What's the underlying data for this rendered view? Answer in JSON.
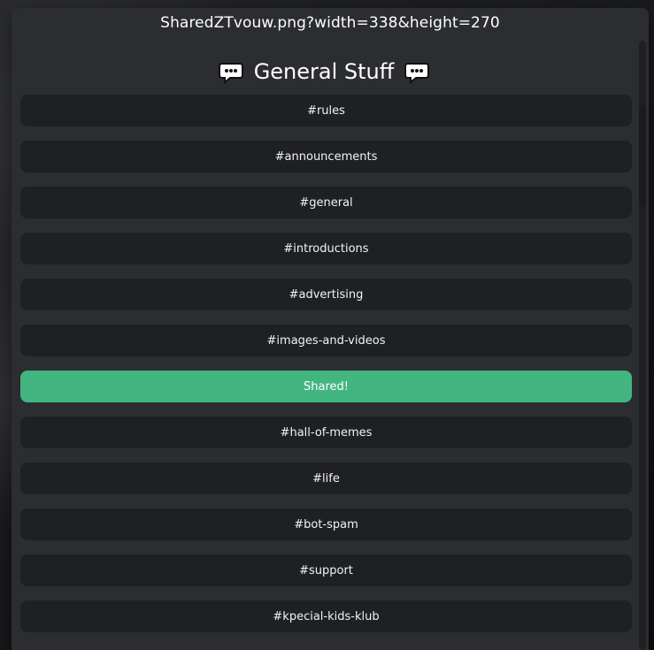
{
  "window": {
    "title": "SharedZTvouw.png?width=338&height=270"
  },
  "header": {
    "title": "General Stuff",
    "left_icon": "speech-bubble-icon",
    "right_icon": "speech-bubble-icon"
  },
  "channels": [
    {
      "label": "#rules",
      "active": false
    },
    {
      "label": "#announcements",
      "active": false
    },
    {
      "label": "#general",
      "active": false
    },
    {
      "label": "#introductions",
      "active": false
    },
    {
      "label": "#advertising",
      "active": false
    },
    {
      "label": "#images-and-videos",
      "active": false
    },
    {
      "label": "Shared!",
      "active": true
    },
    {
      "label": "#hall-of-memes",
      "active": false
    },
    {
      "label": "#life",
      "active": false
    },
    {
      "label": "#bot-spam",
      "active": false
    },
    {
      "label": "#support",
      "active": false
    },
    {
      "label": "#kpecial-kids-klub",
      "active": false
    }
  ],
  "colors": {
    "background": "#2b2d31",
    "button": "#1f2024",
    "active": "#43b581",
    "text": "#f2f3f5"
  }
}
